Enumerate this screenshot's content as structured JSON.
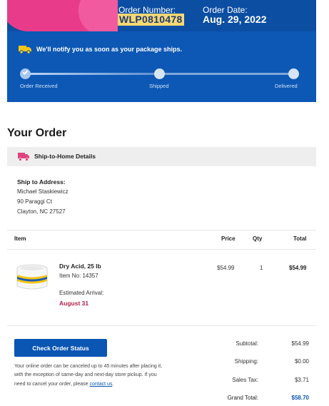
{
  "header": {
    "order_number_label": "Order Number:",
    "order_number": "WLP0810478",
    "order_date_label": "Order Date:",
    "order_date": "Aug. 29, 2022",
    "notify_text": "We'll notify you as soon as your package ships."
  },
  "progress": {
    "steps": [
      "Order Received",
      "Shipped",
      "Delivered"
    ],
    "completed_fraction": 0.5
  },
  "order": {
    "title": "Your Order",
    "details_label": "Ship-to-Home Details",
    "ship_to_title": "Ship to Address:",
    "address": [
      "Michael Staskiewicz",
      "90 Paraggi Ct",
      "Clayton, NC 27527"
    ]
  },
  "table": {
    "headers": {
      "item": "Item",
      "price": "Price",
      "qty": "Qty",
      "total": "Total"
    },
    "rows": [
      {
        "name": "Dry Acid, 25 lb",
        "item_no": "Item No: 14357",
        "arrival_label": "Estimated Arrival:",
        "arrival_date": "August 31",
        "price": "$54.99",
        "qty": "1",
        "total": "$54.99"
      }
    ]
  },
  "actions": {
    "check_status_label": "Check Order Status",
    "cancel_note": "Your online order can be canceled up to 45 minutes after placing it, with the exception of same-day and next-day store pickup. If you need to cancel your order, please ",
    "contact_link": "contact us",
    "cancel_note_end": "."
  },
  "summary": {
    "subtotal_label": "Subtotal:",
    "subtotal": "$54.99",
    "shipping_label": "Shipping:",
    "shipping": "$0.00",
    "tax_label": "Sales Tax:",
    "tax": "$3.71",
    "grand_label": "Grand Total:",
    "grand": "$58.70"
  },
  "colors": {
    "brand_blue": "#0b4ea2",
    "highlight": "#f7d873",
    "arrival_red": "#b0204a"
  },
  "icons": [
    "truck-icon",
    "check-icon",
    "box-icon"
  ]
}
